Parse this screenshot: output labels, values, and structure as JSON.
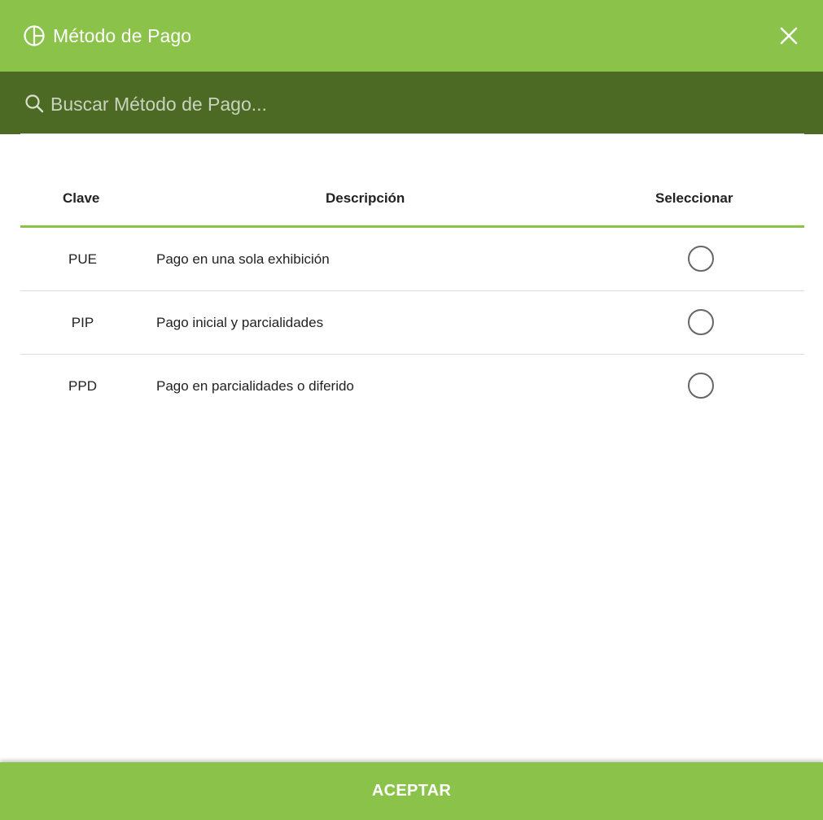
{
  "dialog": {
    "title": "Método de Pago",
    "header_icon": "pie-chart-icon",
    "close_icon": "close-icon",
    "accent_color": "#8bc34a",
    "search_bar_color": "#4c6a24"
  },
  "search": {
    "placeholder": "Buscar Método de Pago...",
    "value": "",
    "icon": "search-icon"
  },
  "table": {
    "headers": {
      "clave": "Clave",
      "descripcion": "Descripción",
      "seleccionar": "Seleccionar"
    },
    "rows": [
      {
        "clave": "PUE",
        "descripcion": "Pago en una sola exhibición",
        "selected": false
      },
      {
        "clave": "PIP",
        "descripcion": "Pago inicial y parcialidades",
        "selected": false
      },
      {
        "clave": "PPD",
        "descripcion": "Pago en parcialidades o diferido",
        "selected": false
      }
    ]
  },
  "footer": {
    "accept_label": "ACEPTAR"
  }
}
